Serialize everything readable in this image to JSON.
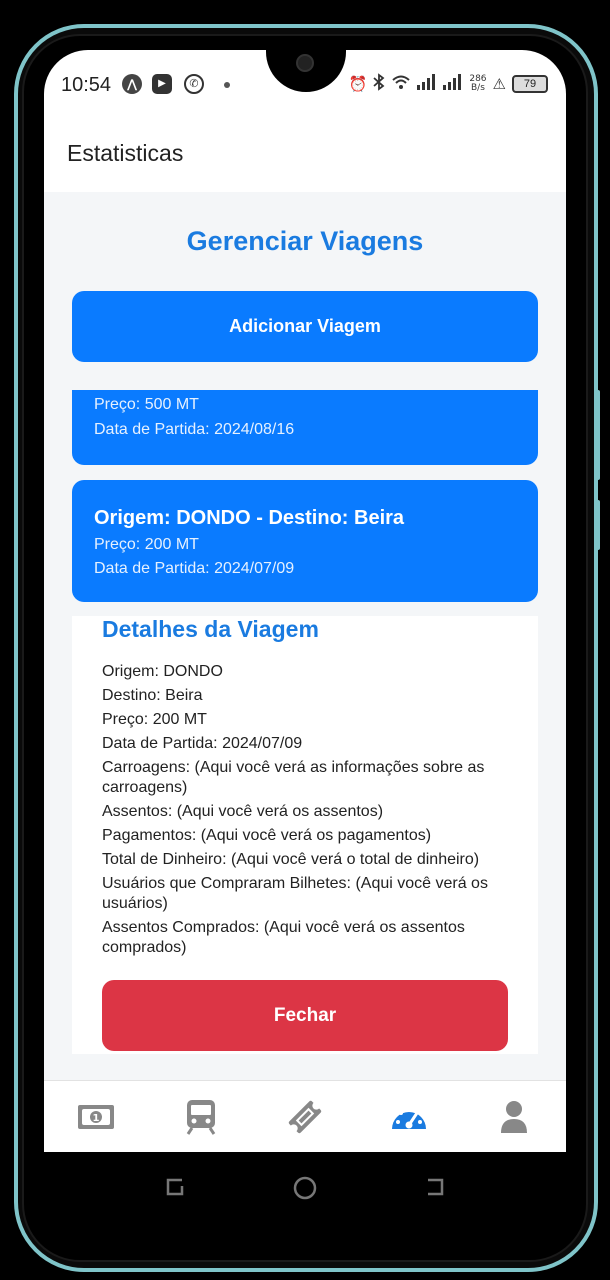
{
  "status_bar": {
    "time": "10:54",
    "speed_value": "286",
    "speed_unit": "B/s",
    "battery": "79"
  },
  "header": {
    "title": "Estatisticas"
  },
  "main": {
    "title": "Gerenciar Viagens",
    "add_button": "Adicionar Viagem",
    "trips": [
      {
        "title": "",
        "price": "Preço: 500 MT",
        "departure": "Data de Partida: 2024/08/16"
      },
      {
        "title": "Origem: DONDO - Destino: Beira",
        "price": "Preço: 200 MT",
        "departure": "Data de Partida: 2024/07/09"
      }
    ]
  },
  "details": {
    "title": "Detalhes da Viagem",
    "origin": "Origem: DONDO",
    "destination": "Destino: Beira",
    "price": "Preço: 200 MT",
    "departure": "Data de Partida: 2024/07/09",
    "carriages": "Carroagens: (Aqui você verá as informações sobre as carroagens)",
    "seats": "Assentos: (Aqui você verá os assentos)",
    "payments": "Pagamentos: (Aqui você verá os pagamentos)",
    "total_money": "Total de Dinheiro: (Aqui você verá o total de dinheiro)",
    "users": "Usuários que Compraram Bilhetes: (Aqui você verá os usuários)",
    "purchased_seats": "Assentos Comprados: (Aqui você verá os assentos comprados)",
    "close_button": "Fechar"
  },
  "bottom_nav": {
    "items": [
      {
        "icon": "money-icon",
        "active": false
      },
      {
        "icon": "train-icon",
        "active": false
      },
      {
        "icon": "ticket-icon",
        "active": false
      },
      {
        "icon": "dashboard-icon",
        "active": true
      },
      {
        "icon": "user-icon",
        "active": false
      }
    ],
    "active_color": "#1a7be0",
    "inactive_color": "#888888"
  },
  "colors": {
    "primary": "#0a7bff",
    "title_blue": "#1a7be0",
    "danger": "#dc3545"
  }
}
